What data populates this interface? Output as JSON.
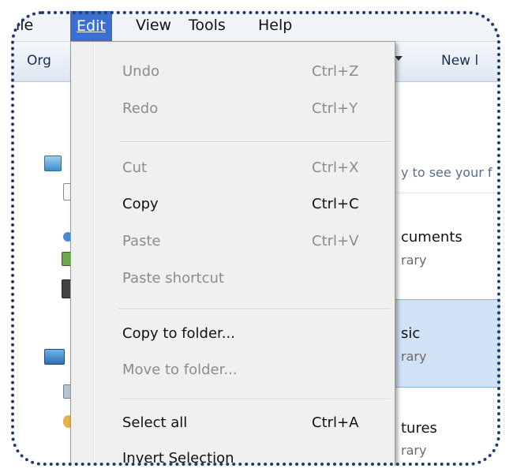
{
  "menubar": {
    "items": [
      {
        "label": "ile"
      },
      {
        "label": "Edit"
      },
      {
        "label": "View"
      },
      {
        "label": "Tools"
      },
      {
        "label": "Help"
      }
    ]
  },
  "toolbar": {
    "organize_label": "Org",
    "new_label": "New l"
  },
  "content": {
    "hint": "y to see your f",
    "libraries": [
      {
        "title": "cuments",
        "sub": "rary"
      },
      {
        "title": "sic",
        "sub": "rary"
      },
      {
        "title": "tures",
        "sub": "rary"
      }
    ]
  },
  "edit_menu": {
    "items": [
      {
        "label": "Undo",
        "shortcut": "Ctrl+Z",
        "enabled": false
      },
      {
        "label": "Redo",
        "shortcut": "Ctrl+Y",
        "enabled": false
      },
      {
        "label": "Cut",
        "shortcut": "Ctrl+X",
        "enabled": false
      },
      {
        "label": "Copy",
        "shortcut": "Ctrl+C",
        "enabled": true
      },
      {
        "label": "Paste",
        "shortcut": "Ctrl+V",
        "enabled": false
      },
      {
        "label": "Paste shortcut",
        "shortcut": "",
        "enabled": false
      },
      {
        "label": "Copy to folder...",
        "shortcut": "",
        "enabled": true
      },
      {
        "label": "Move to folder...",
        "shortcut": "",
        "enabled": false
      },
      {
        "label": "Select all",
        "shortcut": "Ctrl+A",
        "enabled": true
      },
      {
        "label": "Invert Selection",
        "shortcut": "",
        "enabled": true
      }
    ]
  },
  "colors": {
    "active_menu": "#3d6fd0",
    "menu_bg": "#f0f0f0",
    "disabled_text": "#8c8c8c",
    "frame_dots": "#1f3a6b",
    "selected_library": "#cfe2f6"
  }
}
